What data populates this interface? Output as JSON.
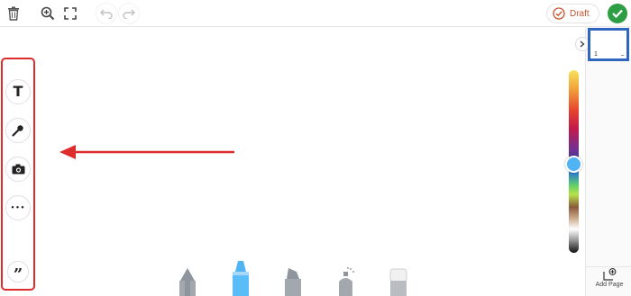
{
  "toolbar": {
    "draft_label": "Draft",
    "icons": [
      "trash-icon",
      "zoom-in-icon",
      "fullscreen-icon",
      "undo-icon",
      "redo-icon",
      "draft-check-icon",
      "done-check-icon"
    ]
  },
  "tools": [
    {
      "name": "text-tool",
      "glyph": "T"
    },
    {
      "name": "microphone-tool",
      "glyph": ""
    },
    {
      "name": "camera-tool",
      "glyph": ""
    },
    {
      "name": "more-tools",
      "glyph": "•••"
    },
    {
      "name": "quote-tool",
      "glyph": "”"
    }
  ],
  "color_picker": {
    "selected_color": "#4fb3f4",
    "selected_position": 0.5
  },
  "pages": {
    "items": [
      {
        "number": "1",
        "more": "..."
      }
    ],
    "add_page_label": "Add Page"
  },
  "pens": [
    "pencil",
    "marker",
    "highlighter",
    "spray",
    "eraser"
  ],
  "colors": {
    "accent_red": "#dd2c2c",
    "selected_page_border": "#2f66c0",
    "done_green": "#2e9e44",
    "draft_orange": "#c9532e"
  }
}
